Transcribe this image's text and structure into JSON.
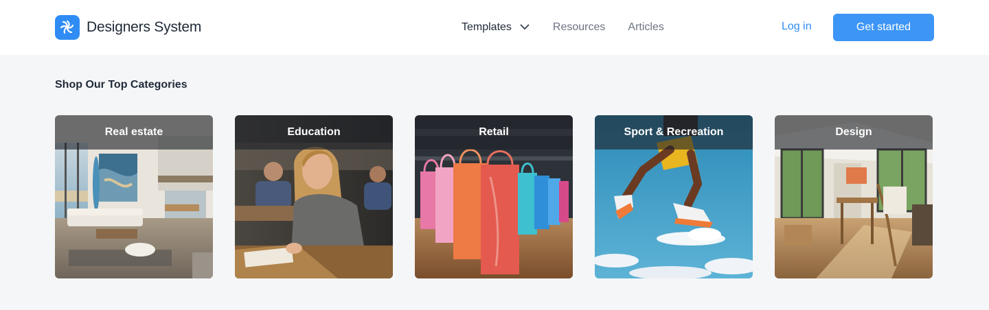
{
  "header": {
    "brand_name": "Designers System",
    "logo_icon": "aperture-icon",
    "nav": {
      "templates": "Templates",
      "resources": "Resources",
      "articles": "Articles"
    },
    "login": "Log in",
    "cta": "Get started"
  },
  "section": {
    "title": "Shop Our Top Categories"
  },
  "categories": [
    {
      "label": "Real estate"
    },
    {
      "label": "Education"
    },
    {
      "label": "Retail"
    },
    {
      "label": "Sport & Recreation"
    },
    {
      "label": "Design"
    }
  ],
  "colors": {
    "accent": "#3d95f6",
    "background": "#f5f6f8",
    "text": "#1f2937"
  }
}
